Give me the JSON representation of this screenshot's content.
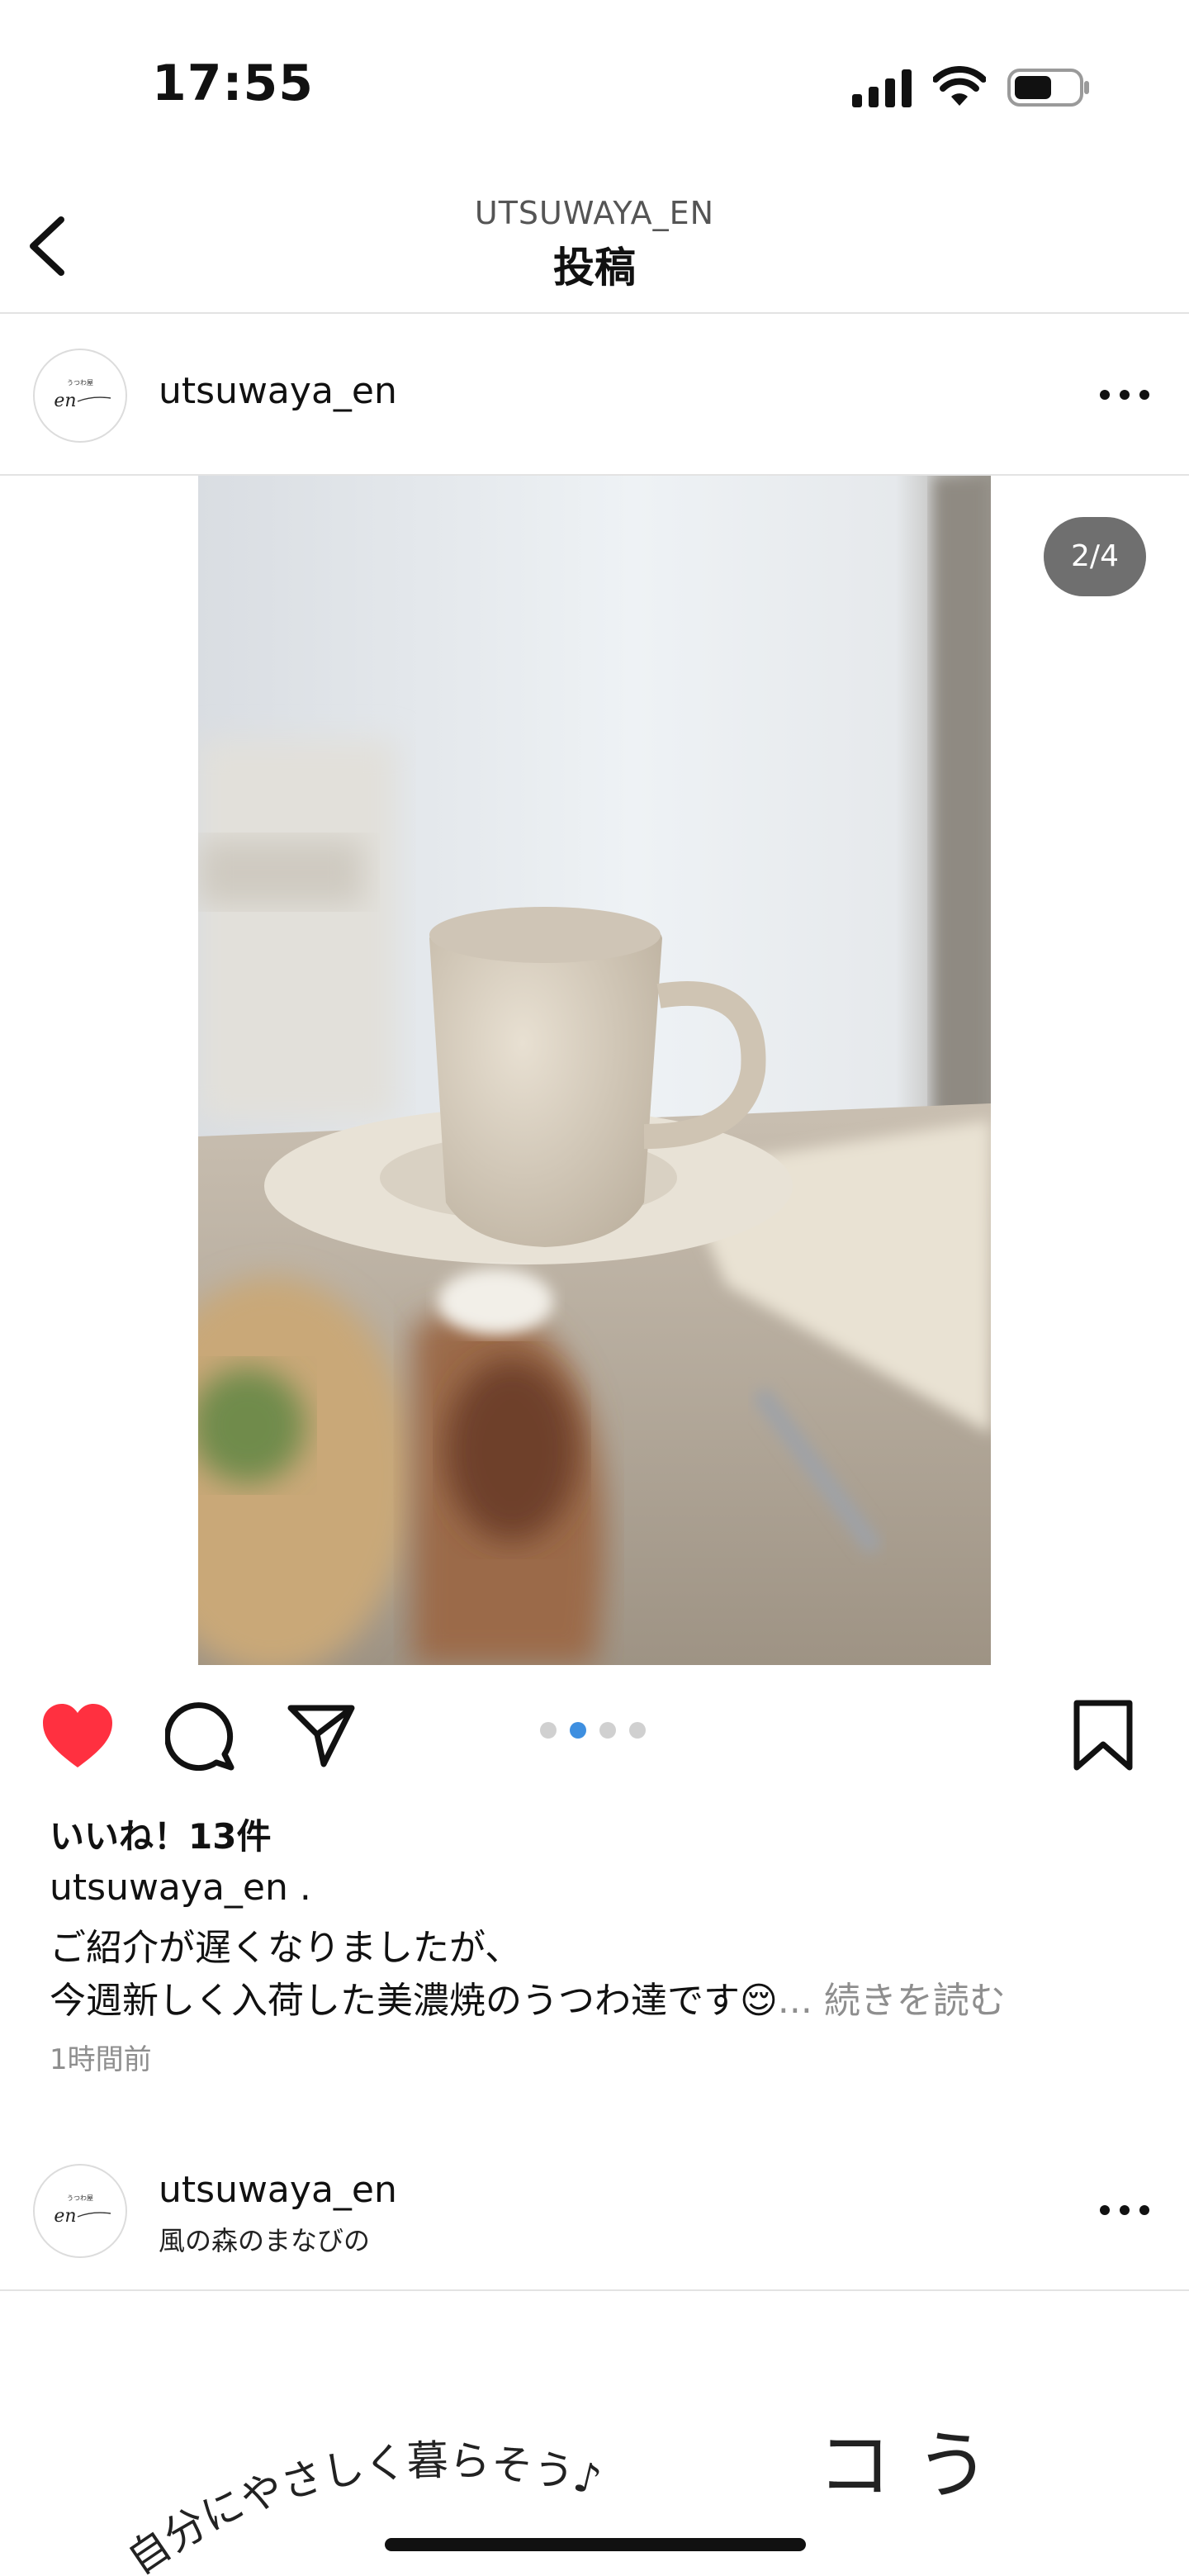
{
  "status_bar": {
    "time": "17:55",
    "battery_level": 0.6
  },
  "nav": {
    "account": "UTSUWAYA_EN",
    "title": "投稿"
  },
  "post": {
    "username": "utsuwaya_en",
    "image_counter": "2/4",
    "carousel": {
      "count": 4,
      "active_index": 1
    },
    "liked": true,
    "likes": "いいね！13件",
    "caption_user": "utsuwaya_en",
    "caption_first_line": " .",
    "caption_line_2": "ご紹介が遅くなりましたが、",
    "caption_line_3": "今週新しく入荷した美濃焼のうつわ達です😌",
    "caption_more": "... 続きを読む",
    "time_ago": "1時間前"
  },
  "next_post": {
    "username": "utsuwaya_en",
    "location": "風の森のまなびの",
    "image_text_arc": "自分にやさしく暮らそう♪",
    "image_text_side": "コ う"
  },
  "avatar_text": {
    "small": "うつわ屋",
    "script": "en"
  },
  "icons": {
    "back": "chevron-left-icon",
    "more": "more-horizontal-icon",
    "like": "heart-icon",
    "comment": "comment-icon",
    "share": "send-icon",
    "save": "bookmark-icon"
  },
  "colors": {
    "like_red": "#ff3040",
    "dot_active": "#3e8fe0",
    "muted": "#8e8e8e"
  }
}
